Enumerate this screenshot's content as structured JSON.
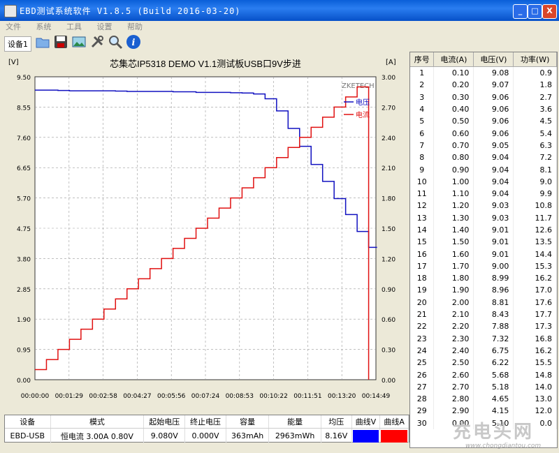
{
  "window": {
    "title": "EBD测试系统软件  V1.8.5 (Build 2016-03-20)",
    "min": "_",
    "max": "□",
    "close": "X"
  },
  "menu": [
    "文件",
    "系统",
    "工具",
    "设置",
    "帮助"
  ],
  "toolbar": {
    "device_tab": "设备1"
  },
  "chart_data": {
    "type": "line",
    "title": "芯集芯IP5318 DEMO V1.1测试板USB口9V步进",
    "left_unit": "[V]",
    "right_unit": "[A]",
    "watermark_label": "ZKETECH",
    "y_left_ticks": [
      "9.50",
      "8.55",
      "7.60",
      "6.65",
      "5.70",
      "4.75",
      "3.80",
      "2.85",
      "1.90",
      "0.95",
      "0.00"
    ],
    "y_right_ticks": [
      "3.00",
      "2.70",
      "2.40",
      "2.10",
      "1.80",
      "1.50",
      "1.20",
      "0.90",
      "0.60",
      "0.30",
      "0.00"
    ],
    "x_ticks": [
      "00:00:00",
      "00:01:29",
      "00:02:58",
      "00:04:27",
      "00:05:56",
      "00:07:24",
      "00:08:53",
      "00:10:22",
      "00:11:51",
      "00:13:20",
      "00:14:49"
    ],
    "ylim_left": [
      0,
      9.5
    ],
    "ylim_right": [
      0,
      3.0
    ],
    "grid": true,
    "legend": "top-right",
    "series": [
      {
        "name": "电压",
        "color": "#1010c0",
        "axis": "left",
        "points": [
          [
            0,
            9.08
          ],
          [
            30,
            9.08
          ],
          [
            60,
            9.07
          ],
          [
            90,
            9.06
          ],
          [
            120,
            9.06
          ],
          [
            150,
            9.06
          ],
          [
            180,
            9.06
          ],
          [
            210,
            9.05
          ],
          [
            240,
            9.04
          ],
          [
            270,
            9.04
          ],
          [
            300,
            9.04
          ],
          [
            330,
            9.04
          ],
          [
            360,
            9.03
          ],
          [
            390,
            9.03
          ],
          [
            420,
            9.01
          ],
          [
            450,
            9.01
          ],
          [
            480,
            9.01
          ],
          [
            510,
            9.0
          ],
          [
            540,
            8.99
          ],
          [
            570,
            8.96
          ],
          [
            600,
            8.81
          ],
          [
            630,
            8.43
          ],
          [
            660,
            7.88
          ],
          [
            690,
            7.32
          ],
          [
            720,
            6.75
          ],
          [
            750,
            6.22
          ],
          [
            780,
            5.68
          ],
          [
            810,
            5.18
          ],
          [
            840,
            4.65
          ],
          [
            870,
            4.15
          ]
        ]
      },
      {
        "name": "电流",
        "color": "#e01010",
        "axis": "right",
        "points": [
          [
            0,
            0.1
          ],
          [
            30,
            0.2
          ],
          [
            60,
            0.3
          ],
          [
            90,
            0.4
          ],
          [
            120,
            0.5
          ],
          [
            150,
            0.6
          ],
          [
            180,
            0.7
          ],
          [
            210,
            0.8
          ],
          [
            240,
            0.9
          ],
          [
            270,
            1.0
          ],
          [
            300,
            1.1
          ],
          [
            330,
            1.2
          ],
          [
            360,
            1.3
          ],
          [
            390,
            1.4
          ],
          [
            420,
            1.5
          ],
          [
            450,
            1.6
          ],
          [
            480,
            1.7
          ],
          [
            510,
            1.8
          ],
          [
            540,
            1.9
          ],
          [
            570,
            2.0
          ],
          [
            600,
            2.1
          ],
          [
            630,
            2.2
          ],
          [
            660,
            2.3
          ],
          [
            690,
            2.4
          ],
          [
            720,
            2.5
          ],
          [
            750,
            2.6
          ],
          [
            780,
            2.7
          ],
          [
            810,
            2.8
          ],
          [
            840,
            2.9
          ],
          [
            870,
            0.0
          ]
        ]
      }
    ]
  },
  "table": {
    "headers": [
      "序号",
      "电流(A)",
      "电压(V)",
      "功率(W)"
    ],
    "rows": [
      [
        "1",
        "0.10",
        "9.08",
        "0.9"
      ],
      [
        "2",
        "0.20",
        "9.07",
        "1.8"
      ],
      [
        "3",
        "0.30",
        "9.06",
        "2.7"
      ],
      [
        "4",
        "0.40",
        "9.06",
        "3.6"
      ],
      [
        "5",
        "0.50",
        "9.06",
        "4.5"
      ],
      [
        "6",
        "0.60",
        "9.06",
        "5.4"
      ],
      [
        "7",
        "0.70",
        "9.05",
        "6.3"
      ],
      [
        "8",
        "0.80",
        "9.04",
        "7.2"
      ],
      [
        "9",
        "0.90",
        "9.04",
        "8.1"
      ],
      [
        "10",
        "1.00",
        "9.04",
        "9.0"
      ],
      [
        "11",
        "1.10",
        "9.04",
        "9.9"
      ],
      [
        "12",
        "1.20",
        "9.03",
        "10.8"
      ],
      [
        "13",
        "1.30",
        "9.03",
        "11.7"
      ],
      [
        "14",
        "1.40",
        "9.01",
        "12.6"
      ],
      [
        "15",
        "1.50",
        "9.01",
        "13.5"
      ],
      [
        "16",
        "1.60",
        "9.01",
        "14.4"
      ],
      [
        "17",
        "1.70",
        "9.00",
        "15.3"
      ],
      [
        "18",
        "1.80",
        "8.99",
        "16.2"
      ],
      [
        "19",
        "1.90",
        "8.96",
        "17.0"
      ],
      [
        "20",
        "2.00",
        "8.81",
        "17.6"
      ],
      [
        "21",
        "2.10",
        "8.43",
        "17.7"
      ],
      [
        "22",
        "2.20",
        "7.88",
        "17.3"
      ],
      [
        "23",
        "2.30",
        "7.32",
        "16.8"
      ],
      [
        "24",
        "2.40",
        "6.75",
        "16.2"
      ],
      [
        "25",
        "2.50",
        "6.22",
        "15.5"
      ],
      [
        "26",
        "2.60",
        "5.68",
        "14.8"
      ],
      [
        "27",
        "2.70",
        "5.18",
        "14.0"
      ],
      [
        "28",
        "2.80",
        "4.65",
        "13.0"
      ],
      [
        "29",
        "2.90",
        "4.15",
        "12.0"
      ],
      [
        "30",
        "0.00",
        "5.10",
        "0.0"
      ]
    ]
  },
  "status": {
    "headers": [
      "设备",
      "模式",
      "起始电压",
      "终止电压",
      "容量",
      "能量",
      "均压",
      "曲线V",
      "曲线A"
    ],
    "values": [
      "EBD-USB",
      "恒电流  3.00A  0.80V",
      "9.080V",
      "0.000V",
      "363mAh",
      "2963mWh",
      "8.16V",
      "",
      ""
    ],
    "curve_v_color": "#0000ff",
    "curve_a_color": "#ff0000"
  },
  "watermark": {
    "big": "充电头网",
    "small": "www.chongdiantou.com"
  }
}
